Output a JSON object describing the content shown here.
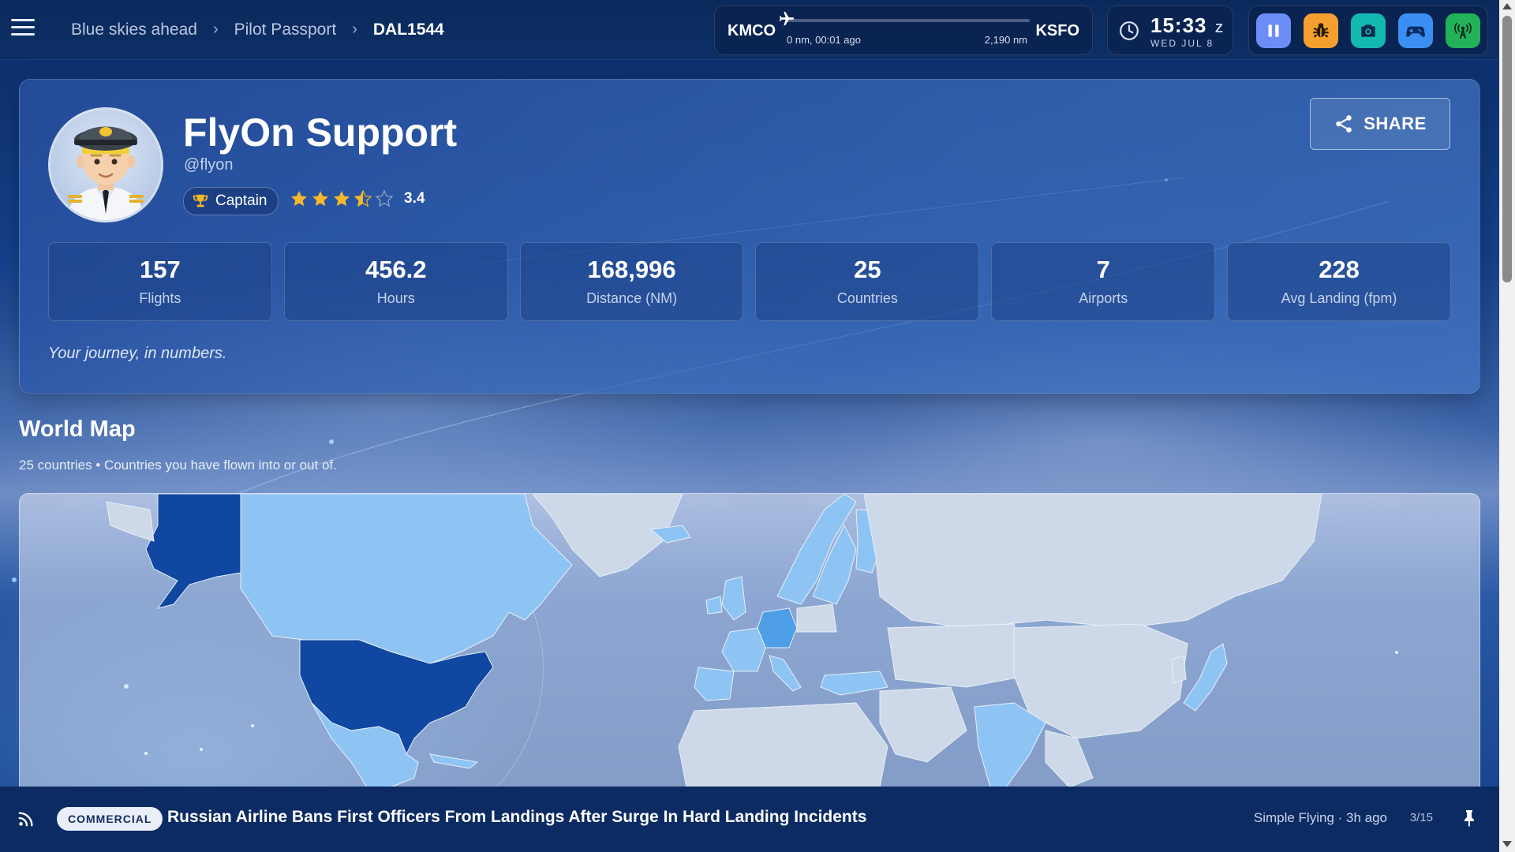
{
  "breadcrumb": {
    "items": [
      "Blue skies ahead",
      "Pilot Passport",
      "DAL1544"
    ]
  },
  "flight": {
    "origin": "KMCO",
    "destination": "KSFO",
    "progress_label": "0 nm, 00:01 ago",
    "remaining_label": "2,190 nm",
    "progress": 0.0
  },
  "clock": {
    "time": "15:33",
    "zone": "Z",
    "date": "WED JUL 8"
  },
  "toolbar": {
    "buttons": [
      {
        "name": "pause",
        "icon": "pause-icon",
        "color": "#6d8df6"
      },
      {
        "name": "bug",
        "icon": "bug-icon",
        "color": "#f59f2e"
      },
      {
        "name": "camera",
        "icon": "camera-icon",
        "color": "#13b8b0"
      },
      {
        "name": "gamepad",
        "icon": "gamepad-icon",
        "color": "#3b8ff3"
      },
      {
        "name": "broadcast",
        "icon": "broadcast-icon",
        "color": "#22b25a"
      }
    ]
  },
  "profile": {
    "name": "FlyOn Support",
    "handle": "@flyon",
    "rank": "Captain",
    "rating": 3.4,
    "rating_label": "3.4",
    "share_label": "SHARE",
    "tagline": "Your journey, in numbers."
  },
  "stats": [
    {
      "value": "157",
      "label": "Flights"
    },
    {
      "value": "456.2",
      "label": "Hours"
    },
    {
      "value": "168,996",
      "label": "Distance (NM)"
    },
    {
      "value": "25",
      "label": "Countries"
    },
    {
      "value": "7",
      "label": "Airports"
    },
    {
      "value": "228",
      "label": "Avg Landing (fpm)"
    }
  ],
  "world_map": {
    "title": "World Map",
    "country_count": "25 countries",
    "subtitle": "Countries you have flown into or out of.",
    "colors": {
      "unvisited": "#cdd9e8",
      "visited": "#8ec4f4",
      "frequent": "#4f9ee8",
      "most": "#0f47a1"
    }
  },
  "news": {
    "tag": "COMMERCIAL",
    "headline": "Russian Airline Bans First Officers From Landings After Surge In Hard Landing Incidents",
    "source": "Simple Flying · 3h ago",
    "count": "3/15"
  }
}
